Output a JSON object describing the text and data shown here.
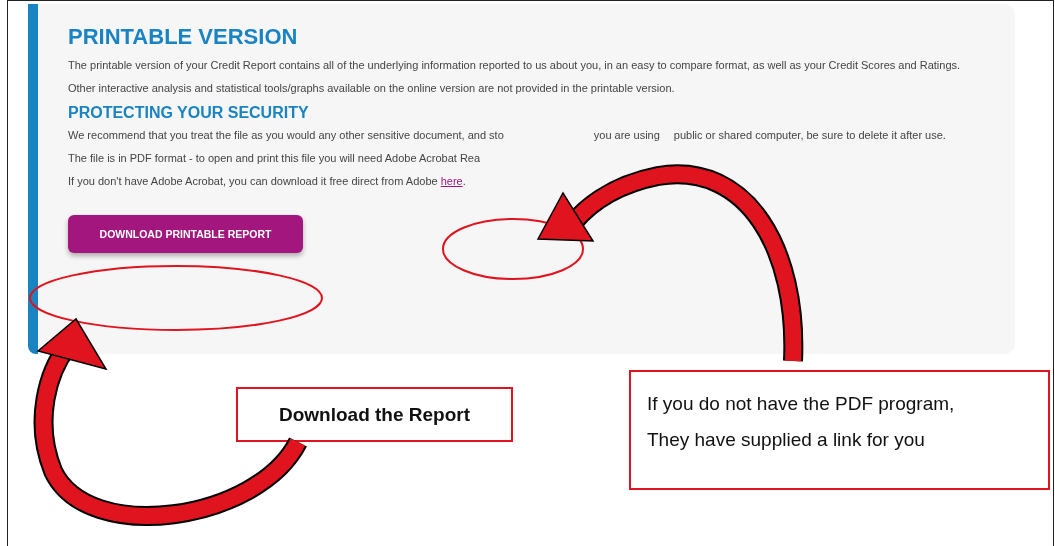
{
  "card": {
    "title": "PRINTABLE VERSION",
    "paragraphs": [
      [
        "The printable version of your Credit Report contains all of the underlying information reported to us about you, in an easy to compare format, as well as your Credit Scores and Ratings."
      ],
      [
        "Other interactive analysis and statistical tools/graphs available on the online version are not provided in the printable version."
      ]
    ],
    "subtitle": "PROTECTING YOUR SECURITY",
    "security_paragraphs": [
      {
        "parts": [
          "We recommend that you treat the file as you would any other sensitive document, and sto",
          "you are using",
          "public or shared computer, be sure to delete it after use."
        ]
      },
      {
        "parts": [
          "The file is in PDF format - to open and print this file you will need Adobe Acrobat Rea"
        ]
      },
      {
        "parts": [
          "If you don't have Adobe Acrobat, you can download it free direct from Adobe"
        ],
        "link": "here",
        "after": "."
      }
    ],
    "button": "DOWNLOAD PRINTABLE REPORT"
  },
  "callouts": [
    {
      "lines": [
        "Download the Report"
      ],
      "kind": "bold"
    },
    {
      "lines": [
        "If you do not have the PDF program,",
        "They have supplied a link for you"
      ],
      "kind": "plain"
    }
  ]
}
